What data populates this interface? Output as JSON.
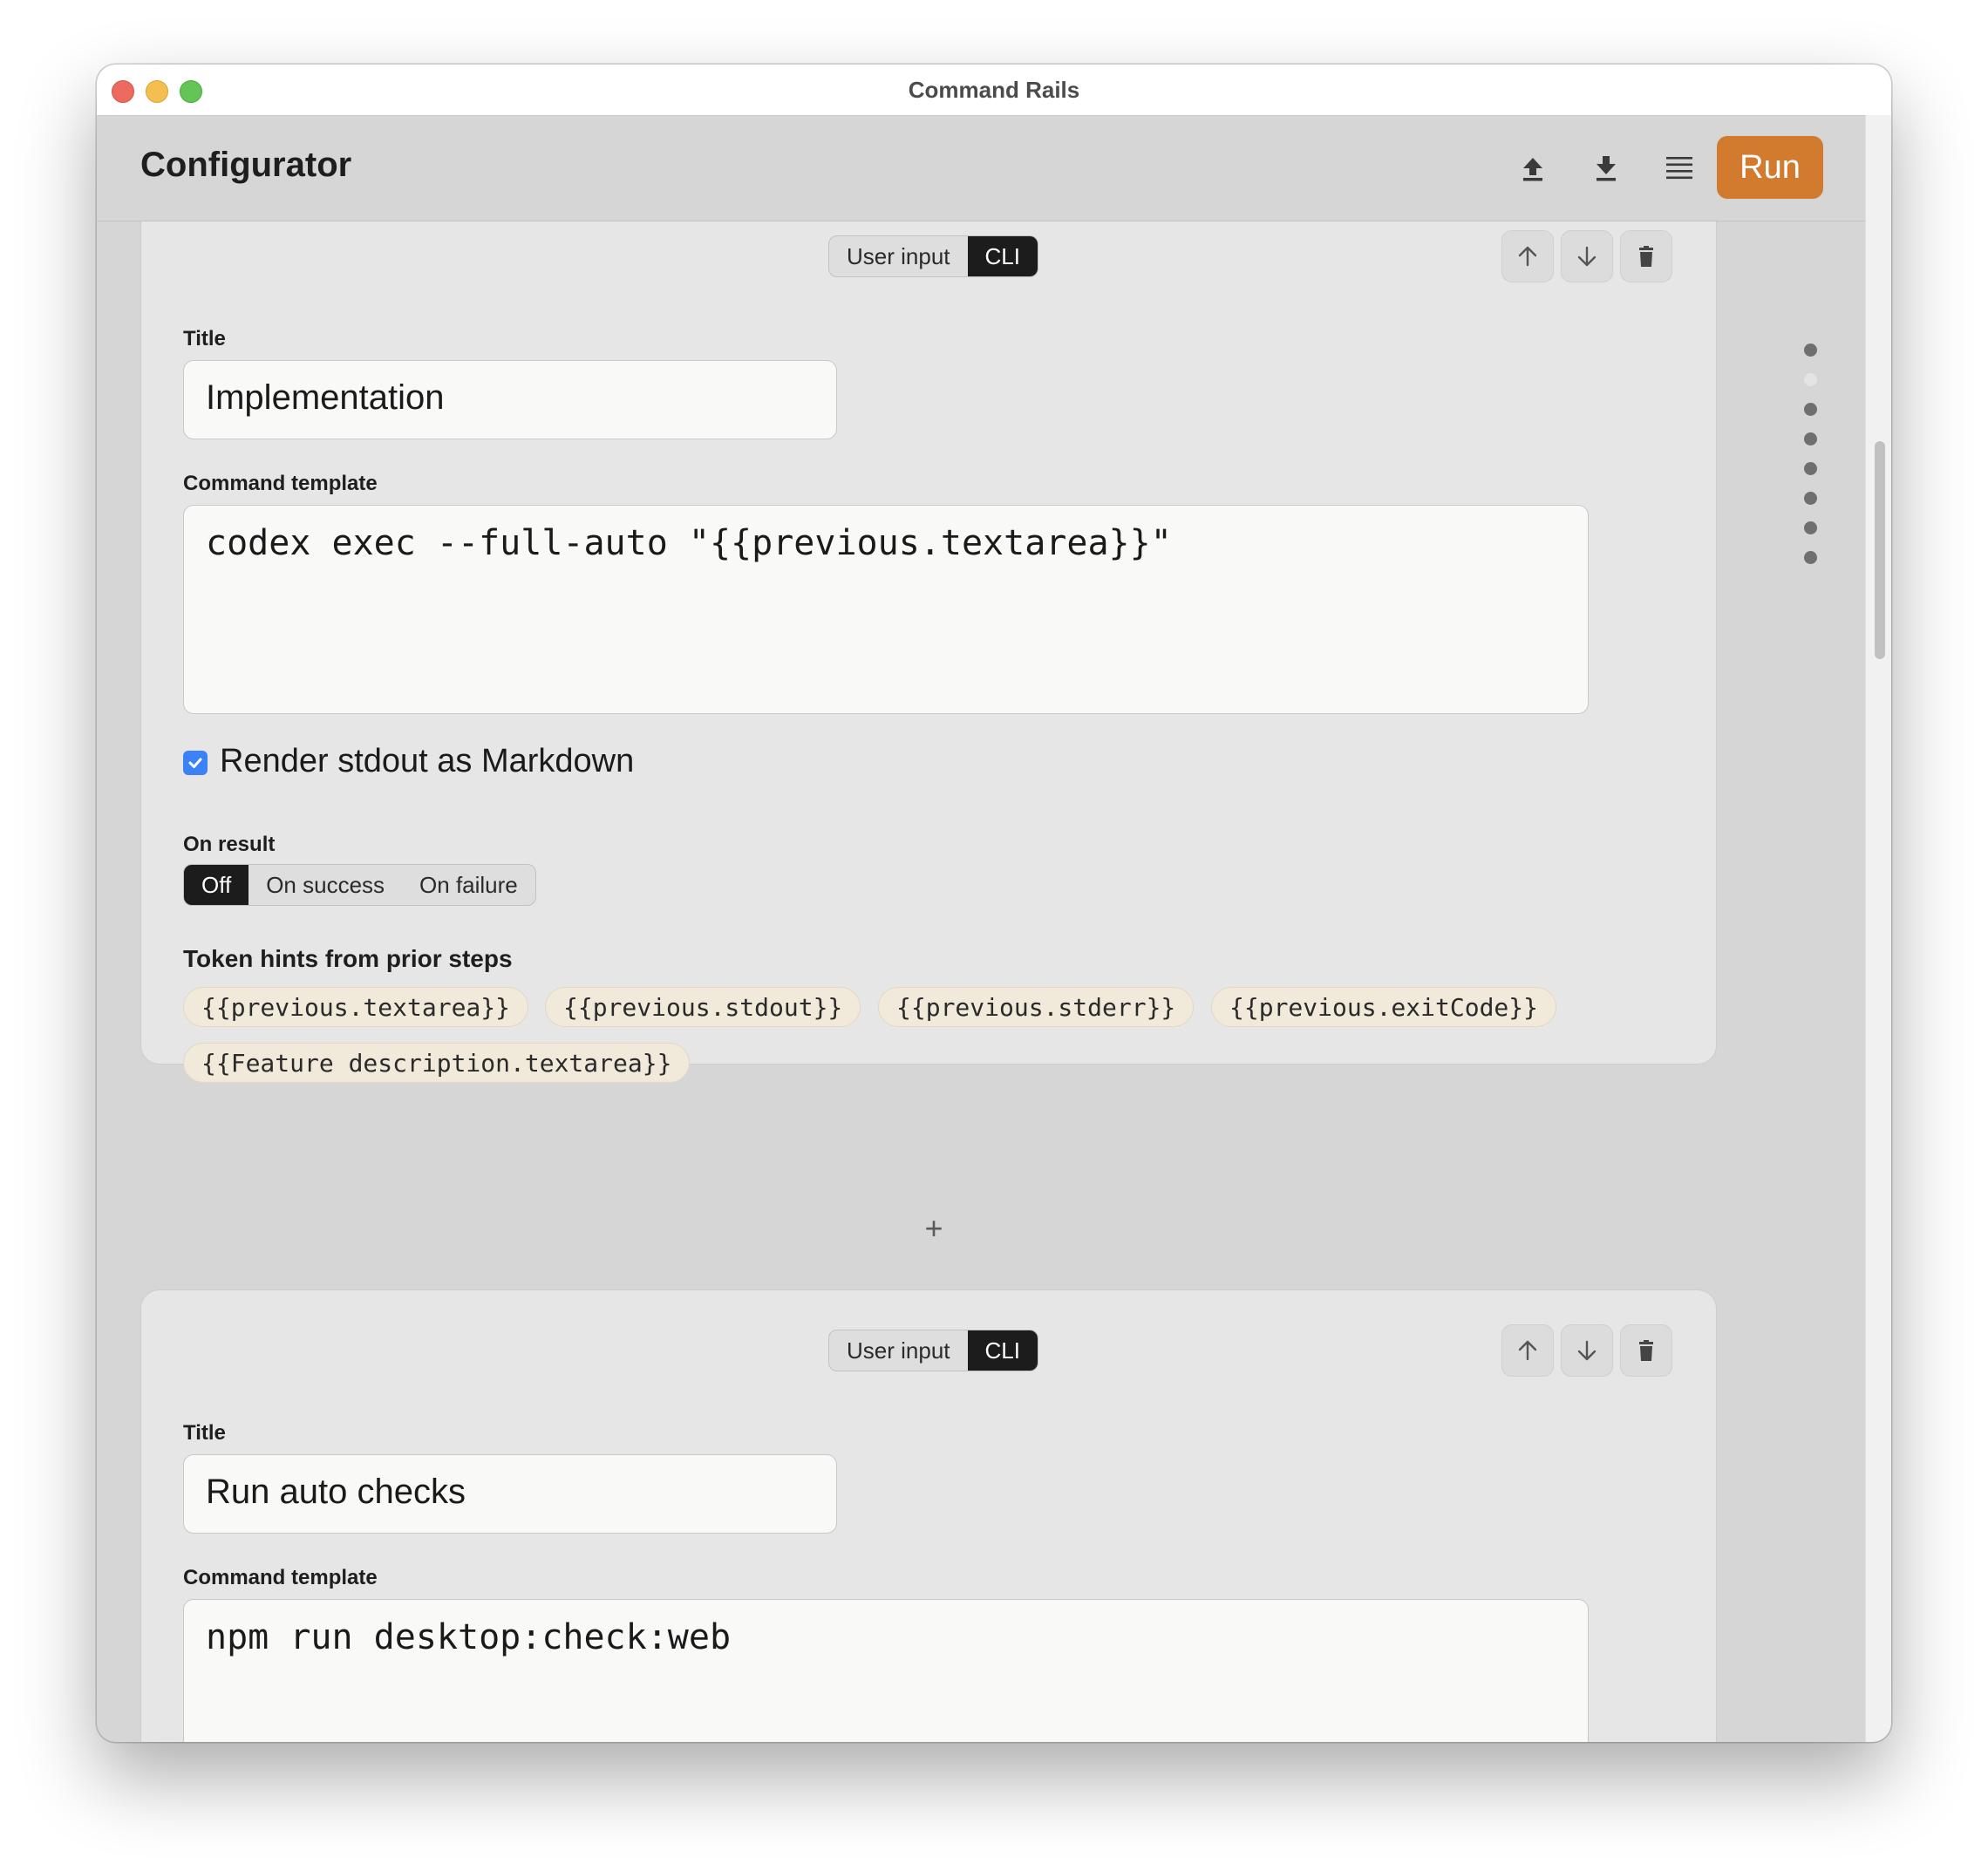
{
  "window": {
    "title": "Command Rails"
  },
  "header": {
    "title": "Configurator",
    "run_label": "Run",
    "icons": [
      "upload-icon",
      "download-icon",
      "menu-icon"
    ]
  },
  "steps": [
    {
      "mode_options": [
        "User input",
        "CLI"
      ],
      "mode_selected": "CLI",
      "title_label": "Title",
      "title_value": "Implementation",
      "command_label": "Command template",
      "command_value": "codex exec --full-auto \"{{previous.textarea}}\"",
      "render_markdown_label": "Render stdout as Markdown",
      "render_markdown_checked": true,
      "on_result_label": "On result",
      "on_result_options": [
        "Off",
        "On success",
        "On failure"
      ],
      "on_result_selected": "Off",
      "token_hints_label": "Token hints from prior steps",
      "token_hints": [
        "{{previous.textarea}}",
        "{{previous.stdout}}",
        "{{previous.stderr}}",
        "{{previous.exitCode}}",
        "{{Feature description.textarea}}"
      ]
    },
    {
      "mode_options": [
        "User input",
        "CLI"
      ],
      "mode_selected": "CLI",
      "title_label": "Title",
      "title_value": "Run auto checks",
      "command_label": "Command template",
      "command_value": "npm run desktop:check:web"
    }
  ],
  "add_step_label": "+",
  "step_nav": {
    "count": 8,
    "current_index": 1
  },
  "colors": {
    "accent": "#d27b2e",
    "checkbox": "#3b82f6",
    "chip_bg": "#f1e9da",
    "segment_active": "#1c1c1c"
  }
}
